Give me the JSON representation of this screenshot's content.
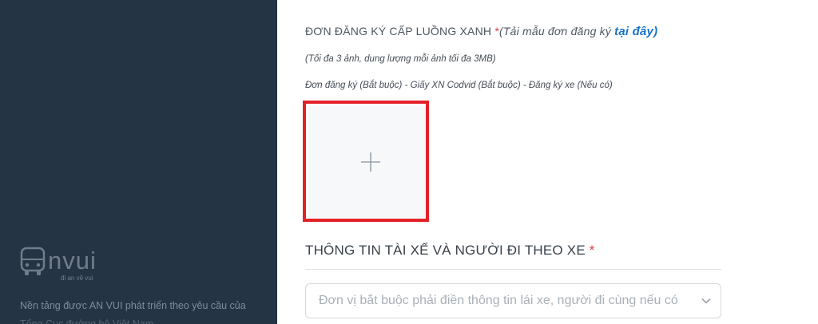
{
  "sidebar": {
    "logo_text": "nvui",
    "logo_tagline": "đi an về vui",
    "description_line1": "Nền tảng được AN VUI phát triển theo yêu cầu của",
    "description_line2": "Tổng Cục đường bộ Việt Nam"
  },
  "form": {
    "registration": {
      "title": "ĐƠN ĐĂNG KÝ CẤP LUỒNG XANH",
      "required_mark": "*",
      "download_hint": "(Tải mẫu đơn đăng ký",
      "download_link": "tại đây)",
      "note_limit": "(Tối đa 3 ảnh, dung lượng mỗi ảnh tối đa 3MB)",
      "note_documents": "Đơn đăng ký (Bắt buộc) - Giấy XN Codvid (Bắt buộc) - Đăng ký xe (Nếu có)",
      "upload_icon": "plus-icon"
    },
    "driver_section": {
      "title": "THÔNG TIN TÀI XẾ VÀ NGƯỜI ĐI THEO XE",
      "required_mark": "*",
      "select_placeholder": "Đơn vị bắt buộc phải điền thông tin lái xe, người đi cùng nếu có",
      "select_icon": "chevron-down-icon"
    }
  },
  "colors": {
    "sidebar_bg": "#243444",
    "required": "#e0383e",
    "link": "#1a73c8",
    "highlight_border": "#e32127"
  }
}
